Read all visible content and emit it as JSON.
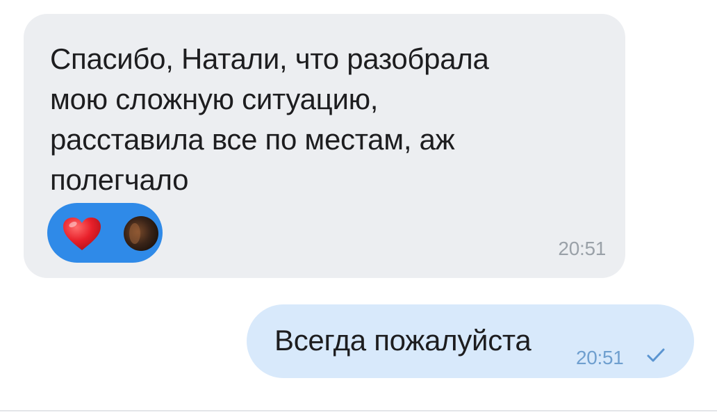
{
  "incoming_message": {
    "lines": [
      "Спасибо, Натали, что разобрала",
      "мою сложную ситуацию,",
      "расставила все по местам, аж",
      "полегчало"
    ],
    "time": "20:51",
    "reactions": [
      {
        "icon": "heart-icon",
        "color": "#e8202a"
      },
      {
        "icon": "reactor-avatar"
      }
    ],
    "bubble_color": "#eceef1",
    "reaction_pill_color": "#2f8ae8"
  },
  "outgoing_message": {
    "text": "Всегда пожалуйста",
    "time": "20:51",
    "status_icon": "check-icon",
    "bubble_color": "#d8e9fb"
  }
}
